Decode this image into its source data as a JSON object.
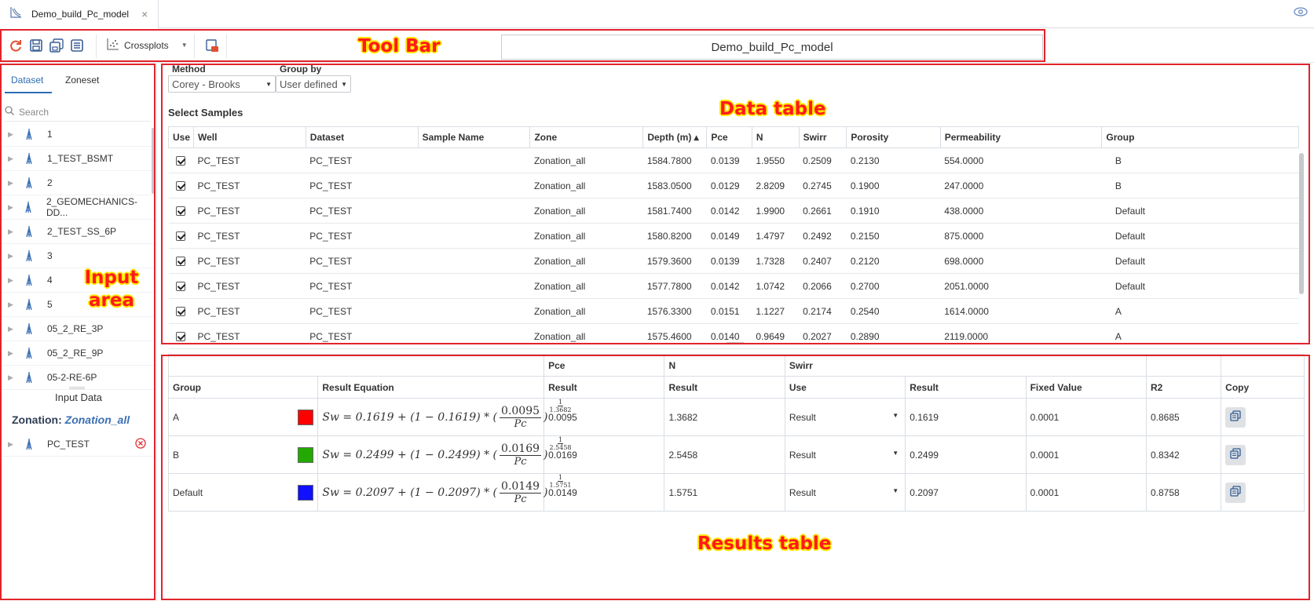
{
  "tab": {
    "title": "Demo_build_Pc_model"
  },
  "toolbar": {
    "crossplots_label": "Crossplots",
    "model_name": "Demo_build_Pc_model"
  },
  "annotations": {
    "toolbar": "Tool Bar",
    "data_table": "Data table",
    "input_area_line1": "Input",
    "input_area_line2": "area",
    "results_table": "Results table"
  },
  "left_panel": {
    "tabs": [
      "Dataset",
      "Zoneset"
    ],
    "search_placeholder": "Search",
    "wells": [
      "1",
      "1_TEST_BSMT",
      "2",
      "2_GEOMECHANICS-DD...",
      "2_TEST_SS_6P",
      "3",
      "4",
      "5",
      "05_2_RE_3P",
      "05_2_RE_9P",
      "05-2-RE-6P"
    ],
    "input_data_title": "Input Data",
    "zonation_label": "Zonation:",
    "zonation_value": "Zonation_all",
    "input_wells": [
      "PC_TEST"
    ]
  },
  "data_panel": {
    "method_label": "Method",
    "method_value": "Corey - Brooks",
    "group_by_label": "Group by",
    "group_by_value": "User defined",
    "select_samples_label": "Select Samples",
    "columns": [
      "Use",
      "Well",
      "Dataset",
      "Sample Name",
      "Zone",
      "Depth (m) ▴",
      "Pce",
      "N",
      "Swirr",
      "Porosity",
      "Permeability",
      "Group"
    ],
    "rows": [
      {
        "well": "PC_TEST",
        "dataset": "PC_TEST",
        "sample": "",
        "zone": "Zonation_all",
        "depth": "1584.7800",
        "pce": "0.0139",
        "n": "1.9550",
        "swirr": "0.2509",
        "porosity": "0.2130",
        "perm": "554.0000",
        "group": "B"
      },
      {
        "well": "PC_TEST",
        "dataset": "PC_TEST",
        "sample": "",
        "zone": "Zonation_all",
        "depth": "1583.0500",
        "pce": "0.0129",
        "n": "2.8209",
        "swirr": "0.2745",
        "porosity": "0.1900",
        "perm": "247.0000",
        "group": "B"
      },
      {
        "well": "PC_TEST",
        "dataset": "PC_TEST",
        "sample": "",
        "zone": "Zonation_all",
        "depth": "1581.7400",
        "pce": "0.0142",
        "n": "1.9900",
        "swirr": "0.2661",
        "porosity": "0.1910",
        "perm": "438.0000",
        "group": "Default"
      },
      {
        "well": "PC_TEST",
        "dataset": "PC_TEST",
        "sample": "",
        "zone": "Zonation_all",
        "depth": "1580.8200",
        "pce": "0.0149",
        "n": "1.4797",
        "swirr": "0.2492",
        "porosity": "0.2150",
        "perm": "875.0000",
        "group": "Default"
      },
      {
        "well": "PC_TEST",
        "dataset": "PC_TEST",
        "sample": "",
        "zone": "Zonation_all",
        "depth": "1579.3600",
        "pce": "0.0139",
        "n": "1.7328",
        "swirr": "0.2407",
        "porosity": "0.2120",
        "perm": "698.0000",
        "group": "Default"
      },
      {
        "well": "PC_TEST",
        "dataset": "PC_TEST",
        "sample": "",
        "zone": "Zonation_all",
        "depth": "1577.7800",
        "pce": "0.0142",
        "n": "1.0742",
        "swirr": "0.2066",
        "porosity": "0.2700",
        "perm": "2051.0000",
        "group": "Default"
      },
      {
        "well": "PC_TEST",
        "dataset": "PC_TEST",
        "sample": "",
        "zone": "Zonation_all",
        "depth": "1576.3300",
        "pce": "0.0151",
        "n": "1.1227",
        "swirr": "0.2174",
        "porosity": "0.2540",
        "perm": "1614.0000",
        "group": "A"
      },
      {
        "well": "PC_TEST",
        "dataset": "PC_TEST",
        "sample": "",
        "zone": "Zonation_all",
        "depth": "1575.4600",
        "pce": "0.0140",
        "n": "0.9649",
        "swirr": "0.2027",
        "porosity": "0.2890",
        "perm": "2119.0000",
        "group": "A"
      }
    ]
  },
  "results": {
    "group_headers": [
      "Pce",
      "N",
      "Swirr"
    ],
    "columns": [
      "Group",
      "Result Equation",
      "Result",
      "Result",
      "Use",
      "Result",
      "Fixed Value",
      "R2",
      "Copy"
    ],
    "rows": [
      {
        "group": "A",
        "color": "#ff0000",
        "eq_sw": "Sw = 0.1619 + (1 − 0.1619) * (",
        "eq_num": "0.0095",
        "eq_den": "Pc",
        "eq_exp_num": "1",
        "eq_exp_den": "1.3682",
        "pce": "0.0095",
        "n": "1.3682",
        "use": "Result",
        "swirr": "0.1619",
        "fixed": "0.0001",
        "r2": "0.8685"
      },
      {
        "group": "B",
        "color": "#22aa00",
        "eq_sw": "Sw = 0.2499 + (1 − 0.2499) * (",
        "eq_num": "0.0169",
        "eq_den": "Pc",
        "eq_exp_num": "1",
        "eq_exp_den": "2.5458",
        "pce": "0.0169",
        "n": "2.5458",
        "use": "Result",
        "swirr": "0.2499",
        "fixed": "0.0001",
        "r2": "0.8342"
      },
      {
        "group": "Default",
        "color": "#1010ff",
        "eq_sw": "Sw = 0.2097 + (1 − 0.2097) * (",
        "eq_num": "0.0149",
        "eq_den": "Pc",
        "eq_exp_num": "1",
        "eq_exp_den": "1.5751",
        "pce": "0.0149",
        "n": "1.5751",
        "use": "Result",
        "swirr": "0.2097",
        "fixed": "0.0001",
        "r2": "0.8758"
      }
    ]
  }
}
